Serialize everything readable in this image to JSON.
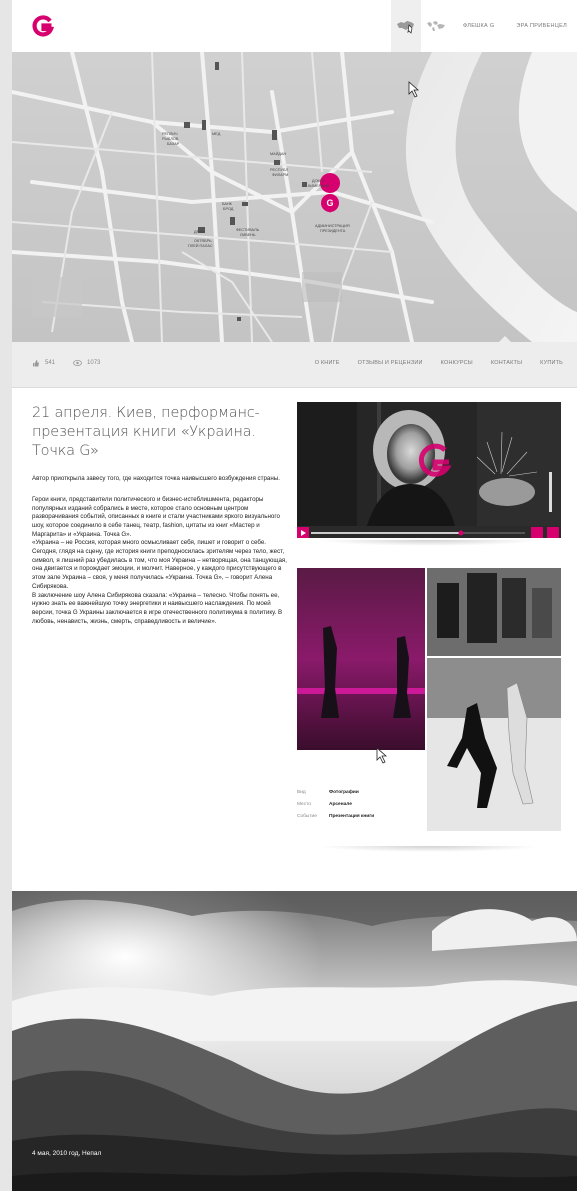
{
  "header": {
    "nav_links": [
      "ФЛЕШКА G",
      "ЭРА ПРИВЕНЦЕЛ"
    ]
  },
  "colors": {
    "accent": "#d6006e",
    "map_bg": "#d9d9d9",
    "subnav_bg": "#ededed"
  },
  "map": {
    "labels": [
      "РЕПЛИЧ",
      "РЫБЛОВ",
      "БАЗАР",
      "МАЙДАН",
      "РЕСПУБЛ",
      "ФИЛАРМ",
      "ДОМ С",
      "КИМЕРАМИ",
      "ЗАНКОВЕЙ",
      "ДРАМ",
      "БАНК",
      "БРОД",
      "АДМИНИСТРАЦИЯ",
      "ПРЕЗИДЕНТА",
      "ФЕСТИВАЛЬ",
      "ЛИВЕНЬ",
      "ОКТЯБРЬ",
      "ДВОРЕЦ",
      "ПЛЕЙ ПАЛАС",
      "МЕД"
    ]
  },
  "subnav": {
    "likes": "541",
    "views": "1073",
    "menu": [
      "О КНИГЕ",
      "ОТЗЫВЫ И РЕЦЕНЗИИ",
      "КОНКУРСЫ",
      "КОНТАКТЫ",
      "КУПИТЬ"
    ]
  },
  "article": {
    "title": "21 апреля. Киев, перформанс-презентация книги «Украина. Точка G»",
    "lead": "Автор приоткрыла завесу того, где находится точка наивысшего возбуждения страны.",
    "paragraphs": [
      "Герои книги, представители политического и бизнес-истеблишмента, редакторы популярных изданий собрались в месте, которое стало основным центром разворачивания событий, описанных в книге и стали участниками яркого визуального шоу, которое соединило в себе танец, театр, fashion, цитаты из книг «Мастер и Маргарита» и «Украина. Точка G».",
      "«Украина – не Россия, которая много осмысливает себя, пишет и говорит о себе. Сегодня, глядя на сцену, где история книги преподносилась зрителям через тело, жест, символ, я лишний раз убедилась в том, что моя Украина – нетворящая, она танцующая, она двигается и порождает эмоции, и молчит. Наверное, у каждого присутствующего в этом зале Украина – своя, у меня получилась «Украина. Точка G», – говорит Алена Сибирякова.",
      "В заключение шоу Алена Сибирякова сказала: «Украина – телесно. Чтобы понять ее, нужно знать ее важнейшую точку энергетики и наивысшего наслаждения. По моей версии, точка G Украины заключается в игре отечественного политикума в политику. В любовь, ненависть, жизнь, смерть, справедливость и величие»."
    ]
  },
  "gallery_meta": [
    {
      "key": "Вид",
      "value": "Фотографии"
    },
    {
      "key": "Место",
      "value": "Арсенале"
    },
    {
      "key": "Событие",
      "value": "Презентация книги"
    }
  ],
  "landscape": {
    "caption": "4 мая, 2010 год, Непал"
  }
}
